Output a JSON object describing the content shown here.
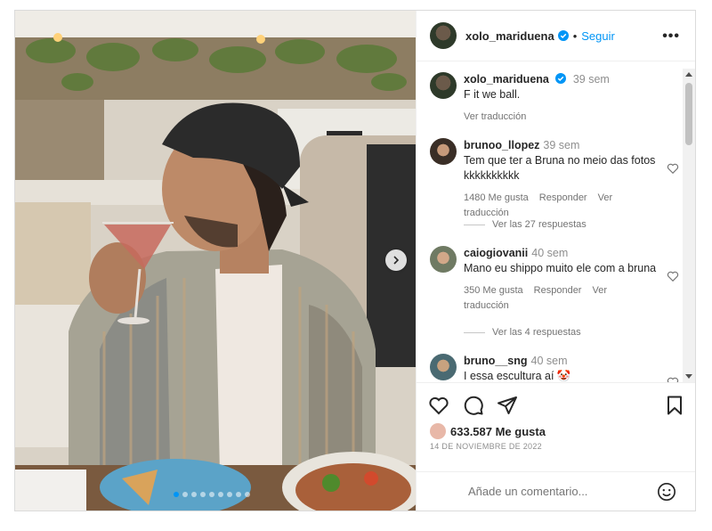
{
  "post": {
    "username": "xolo_mariduena",
    "follow_label": "Seguir",
    "separator": "•",
    "more_label": "•••",
    "carousel_dots": 9,
    "active_dot": 0
  },
  "caption": {
    "username": "xolo_mariduena",
    "time": "39 sem",
    "text": "F it we ball.",
    "translate": "Ver traducción"
  },
  "comments": [
    {
      "username": "brunoo_llopez",
      "time": "39 sem",
      "text": "Tem que ter a Bruna no meio das fotos kkkkkkkkkk",
      "likes": "1480 Me gusta",
      "reply": "Responder",
      "translate": "Ver traducción",
      "replies": "Ver las 27 respuestas"
    },
    {
      "username": "caiogiovanii",
      "time": "40 sem",
      "text": "Mano eu shippo muito ele com a bruna",
      "likes": "350 Me gusta",
      "reply": "Responder",
      "translate": "Ver traducción",
      "replies": "Ver las 4 respuestas"
    },
    {
      "username": "bruno__sng",
      "time": "40 sem",
      "text": "I essa escultura aí 🤡"
    }
  ],
  "footer": {
    "likes_count": "633.587 Me gusta",
    "date": "14 DE NOVIEMBRE DE 2022",
    "comment_placeholder": "Añade un comentario..."
  },
  "icons": {
    "like": "heart-icon",
    "comment": "comment-icon",
    "share": "share-icon",
    "save": "bookmark-icon",
    "emoji": "emoji-icon",
    "next": "chevron-right-icon"
  },
  "colors": {
    "accent": "#0095f6",
    "text": "#262626",
    "muted": "#737373"
  }
}
